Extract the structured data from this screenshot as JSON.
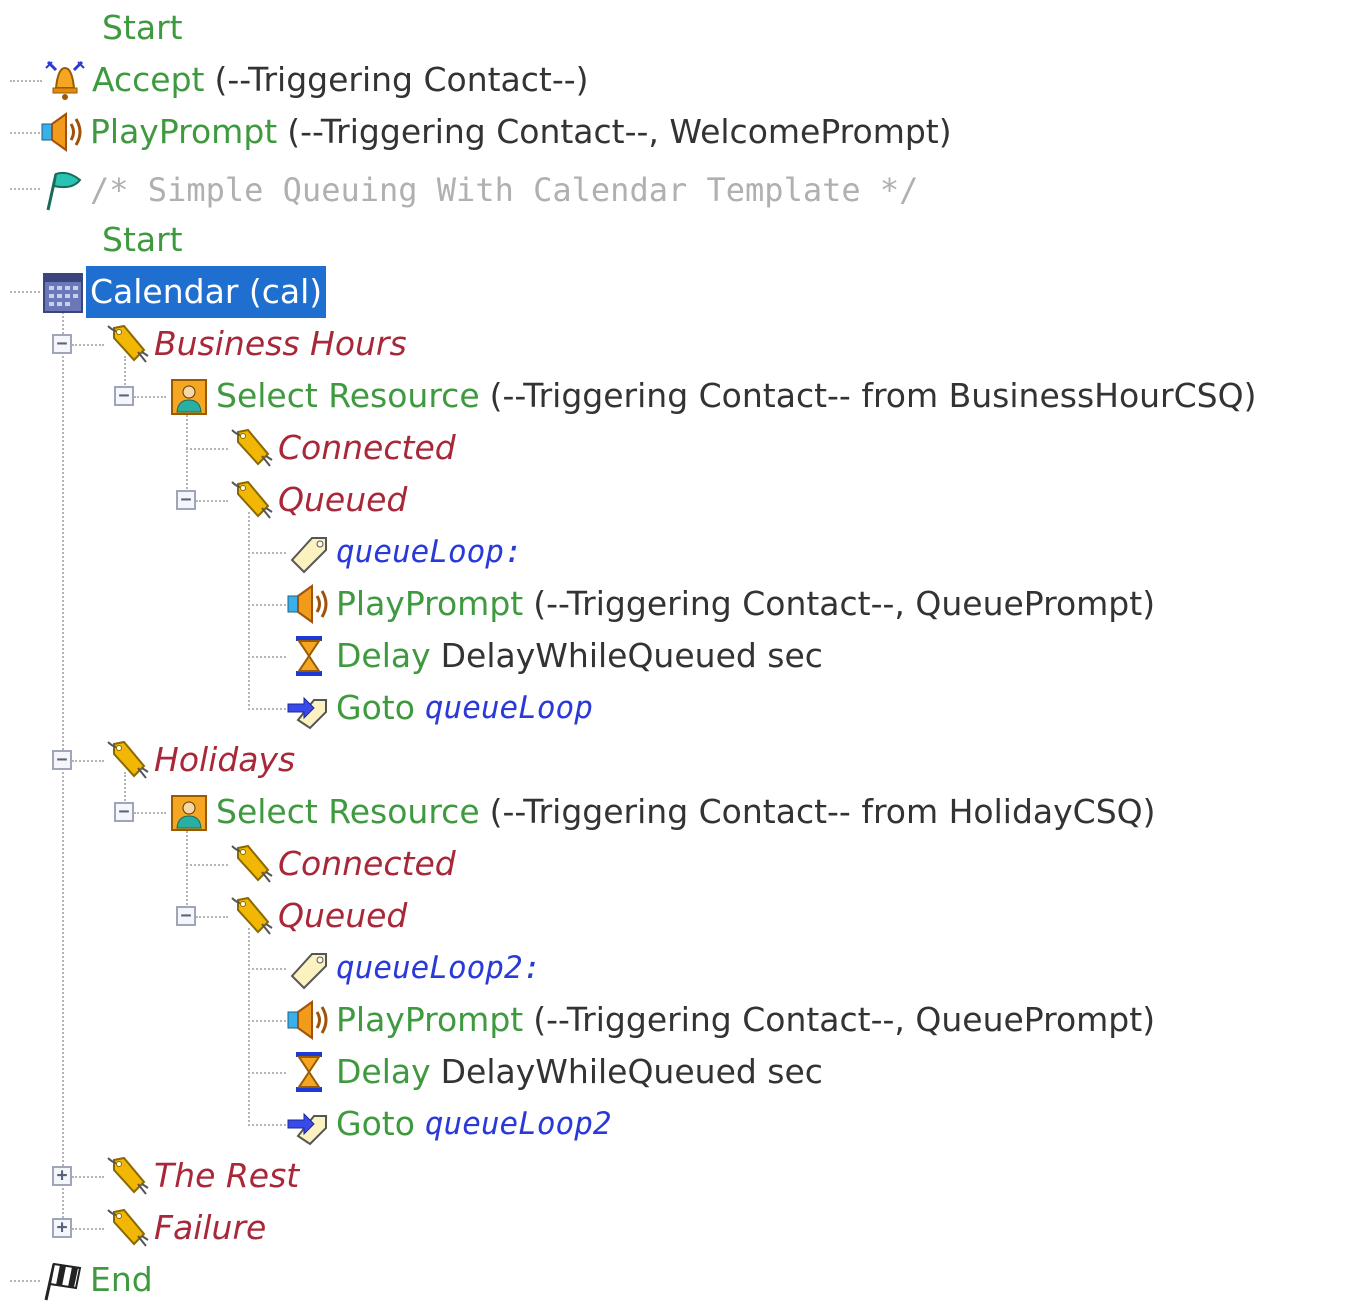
{
  "tree": {
    "start_1": "Start",
    "accept": {
      "cmd": "Accept",
      "args": "(--Triggering Contact--)"
    },
    "play_welcome": {
      "cmd": "PlayPrompt",
      "args": "(--Triggering Contact--, WelcomePrompt)"
    },
    "comment": "/* Simple Queuing With Calendar Template */",
    "start_2": "Start",
    "calendar": "Calendar (cal)",
    "business_hours": {
      "label": "Business Hours",
      "select": {
        "cmd": "Select Resource",
        "args": "(--Triggering Contact-- from BusinessHourCSQ)"
      },
      "connected": "Connected",
      "queued": "Queued",
      "loop_label": "queueLoop:",
      "play": {
        "cmd": "PlayPrompt",
        "args": "(--Triggering Contact--, QueuePrompt)"
      },
      "delay": {
        "cmd": "Delay",
        "args": "DelayWhileQueued sec"
      },
      "goto": {
        "cmd": "Goto",
        "target": "queueLoop"
      }
    },
    "holidays": {
      "label": "Holidays",
      "select": {
        "cmd": "Select Resource",
        "args": "(--Triggering Contact-- from HolidayCSQ)"
      },
      "connected": "Connected",
      "queued": "Queued",
      "loop_label": "queueLoop2:",
      "play": {
        "cmd": "PlayPrompt",
        "args": "(--Triggering Contact--, QueuePrompt)"
      },
      "delay": {
        "cmd": "Delay",
        "args": "DelayWhileQueued sec"
      },
      "goto": {
        "cmd": "Goto",
        "target": "queueLoop2"
      }
    },
    "the_rest": "The Rest",
    "failure": "Failure",
    "end": "End"
  },
  "icons": {
    "accept": "bell-accept-icon",
    "play_prompt": "speaker-icon",
    "comment": "flag-icon",
    "calendar": "calendar-icon",
    "branch": "branch-tag-icon",
    "select_resource": "agent-resource-icon",
    "label": "label-tag-icon",
    "delay": "hourglass-icon",
    "goto": "goto-arrow-icon",
    "end": "checkered-flag-icon"
  },
  "colors": {
    "step": "#3f9a3f",
    "args": "#333333",
    "branch": "#a8283a",
    "label": "#2a3ad8",
    "comment": "#b0b0b0",
    "selection": "#1e6fd0"
  }
}
